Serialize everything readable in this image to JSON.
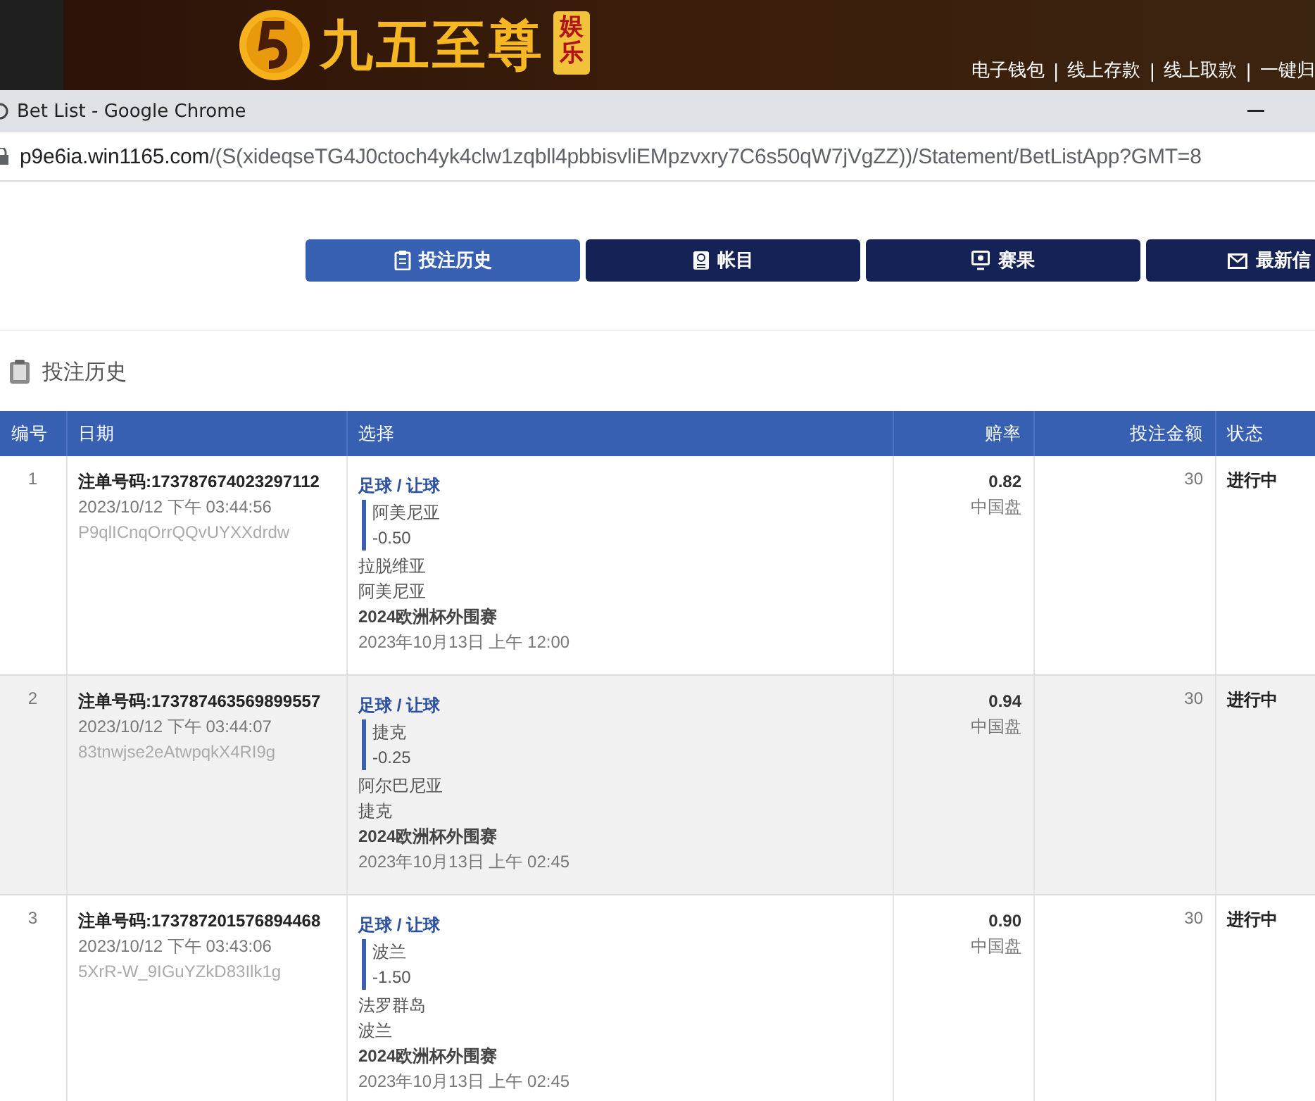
{
  "banner": {
    "brand": "九五至尊",
    "brand_tag": "娱乐",
    "separator": "|",
    "links": [
      "电子钱包",
      "线上存款",
      "线上取款",
      "一键归"
    ]
  },
  "browser": {
    "title": "Bet List - Google Chrome",
    "url_host": "p9e6ia.win1165.com",
    "url_path": "/(S(xideqseTG4J0ctoch4yk4clw1zqbll4pbbisvliEMpzvxry7C6s50qW7jVgZZ))/Statement/BetListApp?GMT=8"
  },
  "nav_tabs": [
    {
      "label": "投注历史",
      "selected": true
    },
    {
      "label": "帐目",
      "selected": false
    },
    {
      "label": "赛果",
      "selected": false
    },
    {
      "label": "最新信",
      "selected": false
    }
  ],
  "section": {
    "title": "投注历史"
  },
  "table": {
    "columns": [
      "编号",
      "日期",
      "选择",
      "赔率",
      "投注金额",
      "状态"
    ],
    "rows": [
      {
        "index": "1",
        "ticket": "注单号码:173787674023297112",
        "placed": "2023/10/12 下午 03:44:56",
        "ref": "P9qlICnqOrrQQvUYXXdrdw",
        "market": "足球 / 让球",
        "pick": "阿美尼亚",
        "handicap": "-0.50",
        "home": "拉脱维亚",
        "away": "阿美尼亚",
        "league": "2024欧洲杯外围赛",
        "kickoff": "2023年10月13日 上午 12:00",
        "odds": "0.82",
        "odds_type": "中国盘",
        "stake": "30",
        "status": "进行中"
      },
      {
        "index": "2",
        "ticket": "注单号码:173787463569899557",
        "placed": "2023/10/12 下午 03:44:07",
        "ref": "83tnwjse2eAtwpqkX4RI9g",
        "market": "足球 / 让球",
        "pick": "捷克",
        "handicap": "-0.25",
        "home": "阿尔巴尼亚",
        "away": "捷克",
        "league": "2024欧洲杯外围赛",
        "kickoff": "2023年10月13日 上午 02:45",
        "odds": "0.94",
        "odds_type": "中国盘",
        "stake": "30",
        "status": "进行中"
      },
      {
        "index": "3",
        "ticket": "注单号码:173787201576894468",
        "placed": "2023/10/12 下午 03:43:06",
        "ref": "5XrR-W_9IGuYZkD83Ilk1g",
        "market": "足球 / 让球",
        "pick": "波兰",
        "handicap": "-1.50",
        "home": "法罗群岛",
        "away": "波兰",
        "league": "2024欧洲杯外围赛",
        "kickoff": "2023年10月13日 上午 02:45",
        "odds": "0.90",
        "odds_type": "中国盘",
        "stake": "30",
        "status": "进行中"
      }
    ]
  }
}
